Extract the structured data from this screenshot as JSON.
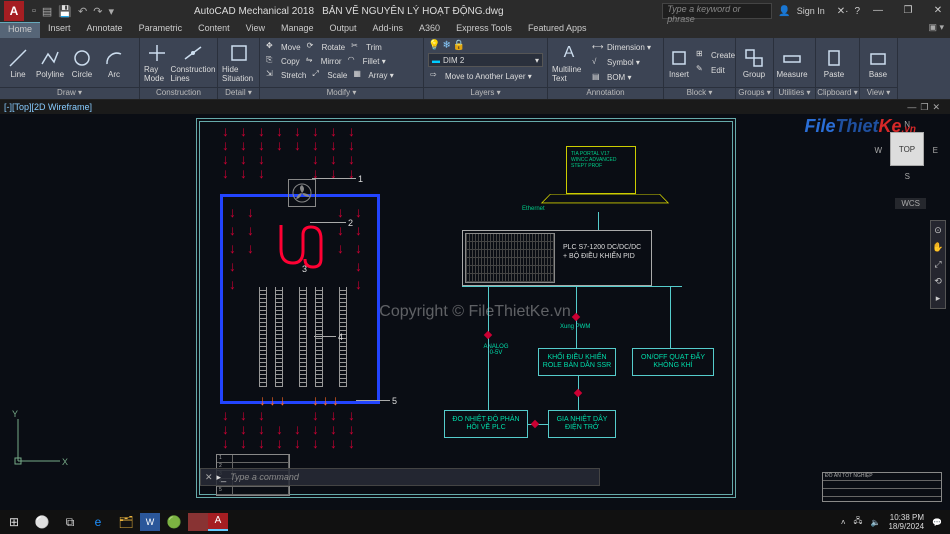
{
  "title": {
    "app": "AutoCAD Mechanical 2018",
    "file": "BẢN VẼ NGUYÊN LÝ HOẠT ĐỘNG.dwg",
    "search_placeholder": "Type a keyword or phrase",
    "signin": "Sign In"
  },
  "menutabs": [
    "Home",
    "Insert",
    "Annotate",
    "Parametric",
    "Content",
    "View",
    "Manage",
    "Output",
    "Add-ins",
    "A360",
    "Express Tools",
    "Featured Apps"
  ],
  "ribbon": {
    "draw": {
      "label": "Draw ▾",
      "line": "Line",
      "polyline": "Polyline",
      "circle": "Circle",
      "arc": "Arc"
    },
    "construction": {
      "label": "Construction",
      "ray": "Ray Mode",
      "clines": "Construction Lines"
    },
    "detail": {
      "label": "Detail ▾",
      "hide": "Hide Situation",
      "situation": "Situation"
    },
    "modify": {
      "label": "Modify ▾",
      "row1": {
        "move": "Move",
        "rotate": "Rotate",
        "trim": "Trim",
        "array": "Array ▾"
      },
      "row2": {
        "copy": "Copy",
        "mirror": "Mirror",
        "fillet": "Fillet ▾",
        "scale": "Scale"
      },
      "row3": {
        "stretch": "Stretch",
        "scale2": "Scale",
        "offset": ""
      }
    },
    "layers": {
      "label": "Layers ▾",
      "layer_val": "DIM 2",
      "move_layer": "Move to Another Layer ▾"
    },
    "annotation": {
      "label": "Annotation",
      "multiline": "Multiline Text",
      "dimension": "Dimension ▾",
      "symbol": "Symbol ▾",
      "bom": "BOM ▾"
    },
    "block": {
      "label": "Block ▾",
      "insert": "Insert",
      "create": "Create",
      "edit": "Edit"
    },
    "groups": {
      "label": "Groups ▾",
      "group": "Group"
    },
    "utilities": {
      "label": "Utilities ▾",
      "measure": "Measure"
    },
    "clipboard": {
      "label": "Clipboard ▾",
      "paste": "Paste"
    },
    "view": {
      "label": "View ▾",
      "base": "Base"
    }
  },
  "filetab": "[-][Top][2D Wireframe]",
  "laptop_text": "TIA PORTAL V17\nWINCC ADVANCED\nSTEP7 PROF",
  "ethernet": "Ethernet",
  "plc": {
    "line1": "PLC S7-1200 DC/DC/DC",
    "line2": "+ BỘ ĐIỀU KHIỂN PID"
  },
  "blocks": {
    "analog": "ANALOG\n0-5V",
    "xung": "Xung PWM",
    "ssr": "KHỐI ĐIỀU KHIỂN\nROLE BÁN DẪN SSR",
    "fan": "ON/OFF QUẠT ĐẨY\nKHÔNG KHÍ",
    "temp": "ĐO NHIỆT ĐỘ\nPHẢN HỒI VỀ PLC",
    "heat": "GIA NHIỆT\nDÂY ĐIỆN TRỞ"
  },
  "callouts": {
    "c1": "1",
    "c2": "2",
    "c3": "3",
    "c4": "4",
    "c5": "5"
  },
  "viewcube": {
    "face": "TOP",
    "n": "N",
    "e": "E",
    "s": "S",
    "w": "W",
    "wcs": "WCS"
  },
  "ucs": {
    "x": "X",
    "y": "Y"
  },
  "titleblock": "ĐỒ ÁN TỐT NGHIỆP",
  "cmdline": {
    "prompt": "Type a command"
  },
  "watermark": "Copyright © FileThietKe.vn",
  "brand": {
    "p1": "File",
    "p2": "Thiet",
    "p3": "Ke",
    "vn": ".vn"
  },
  "taskbar": {
    "time": "10:38 PM",
    "date": "18/9/2024"
  }
}
